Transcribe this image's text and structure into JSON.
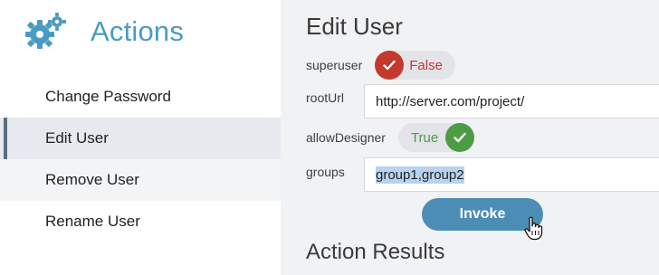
{
  "sidebar": {
    "title": "Actions",
    "icon": "gears-icon",
    "items": [
      {
        "label": "Change Password"
      },
      {
        "label": "Edit User"
      },
      {
        "label": "Remove User"
      },
      {
        "label": "Rename User"
      }
    ]
  },
  "main": {
    "title": "Edit User",
    "fields": {
      "superuser": {
        "label": "superuser",
        "value": "False"
      },
      "rootUrl": {
        "label": "rootUrl",
        "value": "http://server.com/project/"
      },
      "allowDesigner": {
        "label": "allowDesigner",
        "value": "True"
      },
      "groups": {
        "label": "groups",
        "value": "group1,group2"
      }
    },
    "invoke_label": "Invoke",
    "results_title": "Action Results"
  },
  "colors": {
    "accent": "#4a9bc4",
    "false": "#c4392d",
    "true": "#4c9c45",
    "button": "#4c8db6"
  }
}
